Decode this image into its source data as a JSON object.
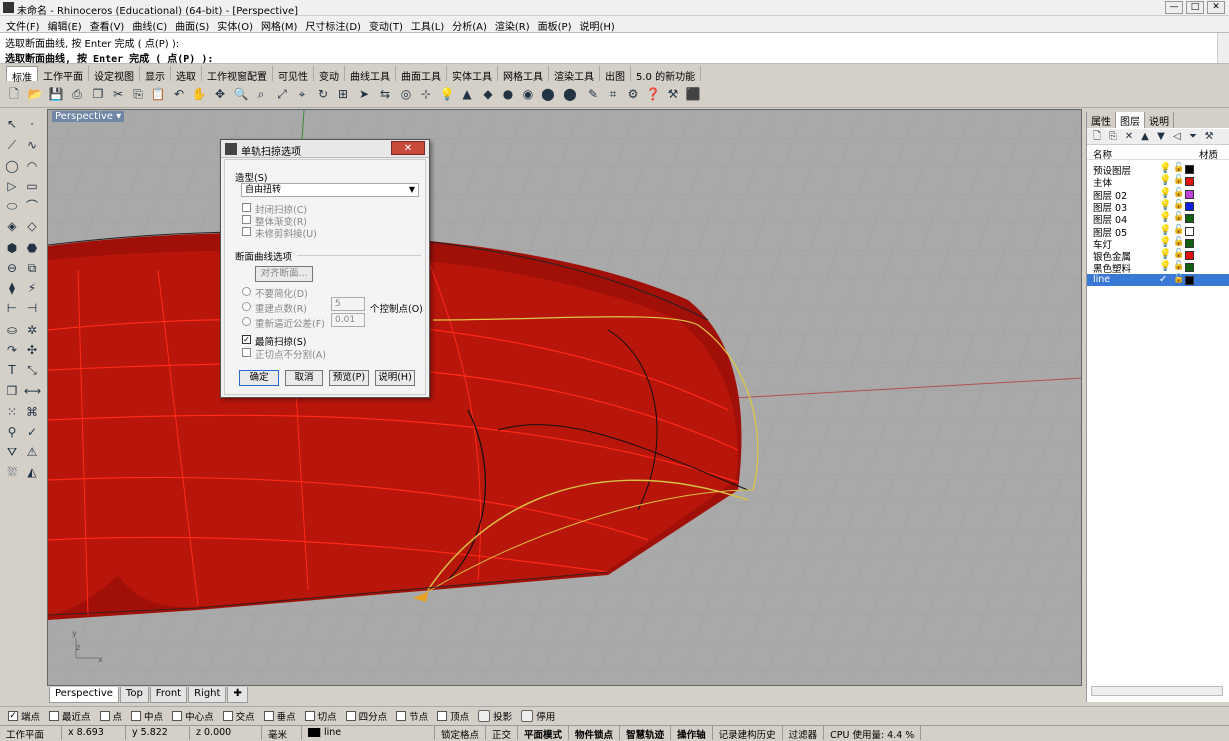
{
  "window": {
    "title": "未命名 - Rhinoceros (Educational) (64-bit) - [Perspective]",
    "minimize": "—",
    "maximize": "□",
    "close": "✕"
  },
  "menu": [
    "文件(F)",
    "编辑(E)",
    "查看(V)",
    "曲线(C)",
    "曲面(S)",
    "实体(O)",
    "网格(M)",
    "尺寸标注(D)",
    "变动(T)",
    "工具(L)",
    "分析(A)",
    "渲染(R)",
    "面板(P)",
    "说明(H)"
  ],
  "command": {
    "line1": "选取断面曲线, 按 Enter 完成 ( 点(P) ):",
    "line2": "选取断面曲线, 按 Enter 完成 ( 点(P) ):"
  },
  "tabs": [
    "标准",
    "工作平面",
    "设定视图",
    "显示",
    "选取",
    "工作视窗配置",
    "可见性",
    "变动",
    "曲线工具",
    "曲面工具",
    "实体工具",
    "网格工具",
    "渲染工具",
    "出图",
    "5.0 的新功能"
  ],
  "viewport": {
    "label": "Perspective",
    "axis_y": "y",
    "axis_z": "z",
    "axis_x": "x"
  },
  "viewport_tabs": [
    "Perspective",
    "Top",
    "Front",
    "Right"
  ],
  "dialog": {
    "title": "单轨扫掠选项",
    "style_label": "造型(S)",
    "style_value": "自由扭转",
    "opt_closed": "封闭扫掠(C)",
    "opt_global": "整体渐变(R)",
    "opt_untrimmed": "未修剪斜接(U)",
    "section_label": "断面曲线选项",
    "align_button": "对齐断面...",
    "radio_nosimplify": "不要简化(D)",
    "radio_rebuild": "重建点数(R)",
    "rebuild_value": "5",
    "rebuild_unit": "个控制点(O)",
    "radio_refit": "重新逼近公差(F)",
    "refit_value": "0.01",
    "opt_simple": "最简扫掠(S)",
    "opt_tangent": "正切点不分割(A)",
    "btn_ok": "确定",
    "btn_cancel": "取消",
    "btn_preview": "预览(P)",
    "btn_help": "说明(H)"
  },
  "panel": {
    "tabs": [
      "属性",
      "图层",
      "说明"
    ],
    "col_name": "名称",
    "col_material": "材质",
    "layers": [
      {
        "name": "预设图层",
        "color": "#000000"
      },
      {
        "name": "主体",
        "color": "#e01010"
      },
      {
        "name": "图层 02",
        "color": "#c040e0"
      },
      {
        "name": "图层 03",
        "color": "#1020e0"
      },
      {
        "name": "图层 04",
        "color": "#106010"
      },
      {
        "name": "图层 05",
        "color": "#ffffff"
      },
      {
        "name": "车灯",
        "color": "#106010"
      },
      {
        "name": "银色金属",
        "color": "#e01010"
      },
      {
        "name": "黑色塑料",
        "color": "#106010"
      },
      {
        "name": "line",
        "color": "#000000",
        "selected": true
      }
    ]
  },
  "snaps": [
    {
      "label": "端点",
      "checked": true
    },
    {
      "label": "最近点",
      "checked": false
    },
    {
      "label": "点",
      "checked": false
    },
    {
      "label": "中点",
      "checked": false
    },
    {
      "label": "中心点",
      "checked": false
    },
    {
      "label": "交点",
      "checked": false
    },
    {
      "label": "垂点",
      "checked": false
    },
    {
      "label": "切点",
      "checked": false
    },
    {
      "label": "四分点",
      "checked": false
    },
    {
      "label": "节点",
      "checked": false
    },
    {
      "label": "顶点",
      "checked": false
    }
  ],
  "snap_extra": [
    "投影",
    "停用"
  ],
  "status": {
    "plane": "工作平面",
    "x": "x 8.693",
    "y": "y 5.822",
    "z": "z 0.000",
    "unit": "毫米",
    "layer": "line",
    "lock_grid": "锁定格点",
    "ortho": "正交",
    "planar": "平面模式",
    "osnap": "物件锁点",
    "smarttrack": "智慧轨迹",
    "gumball": "操作轴",
    "history": "记录建构历史",
    "filter": "过滤器",
    "cpu": "CPU 使用量: 4.4 %"
  }
}
